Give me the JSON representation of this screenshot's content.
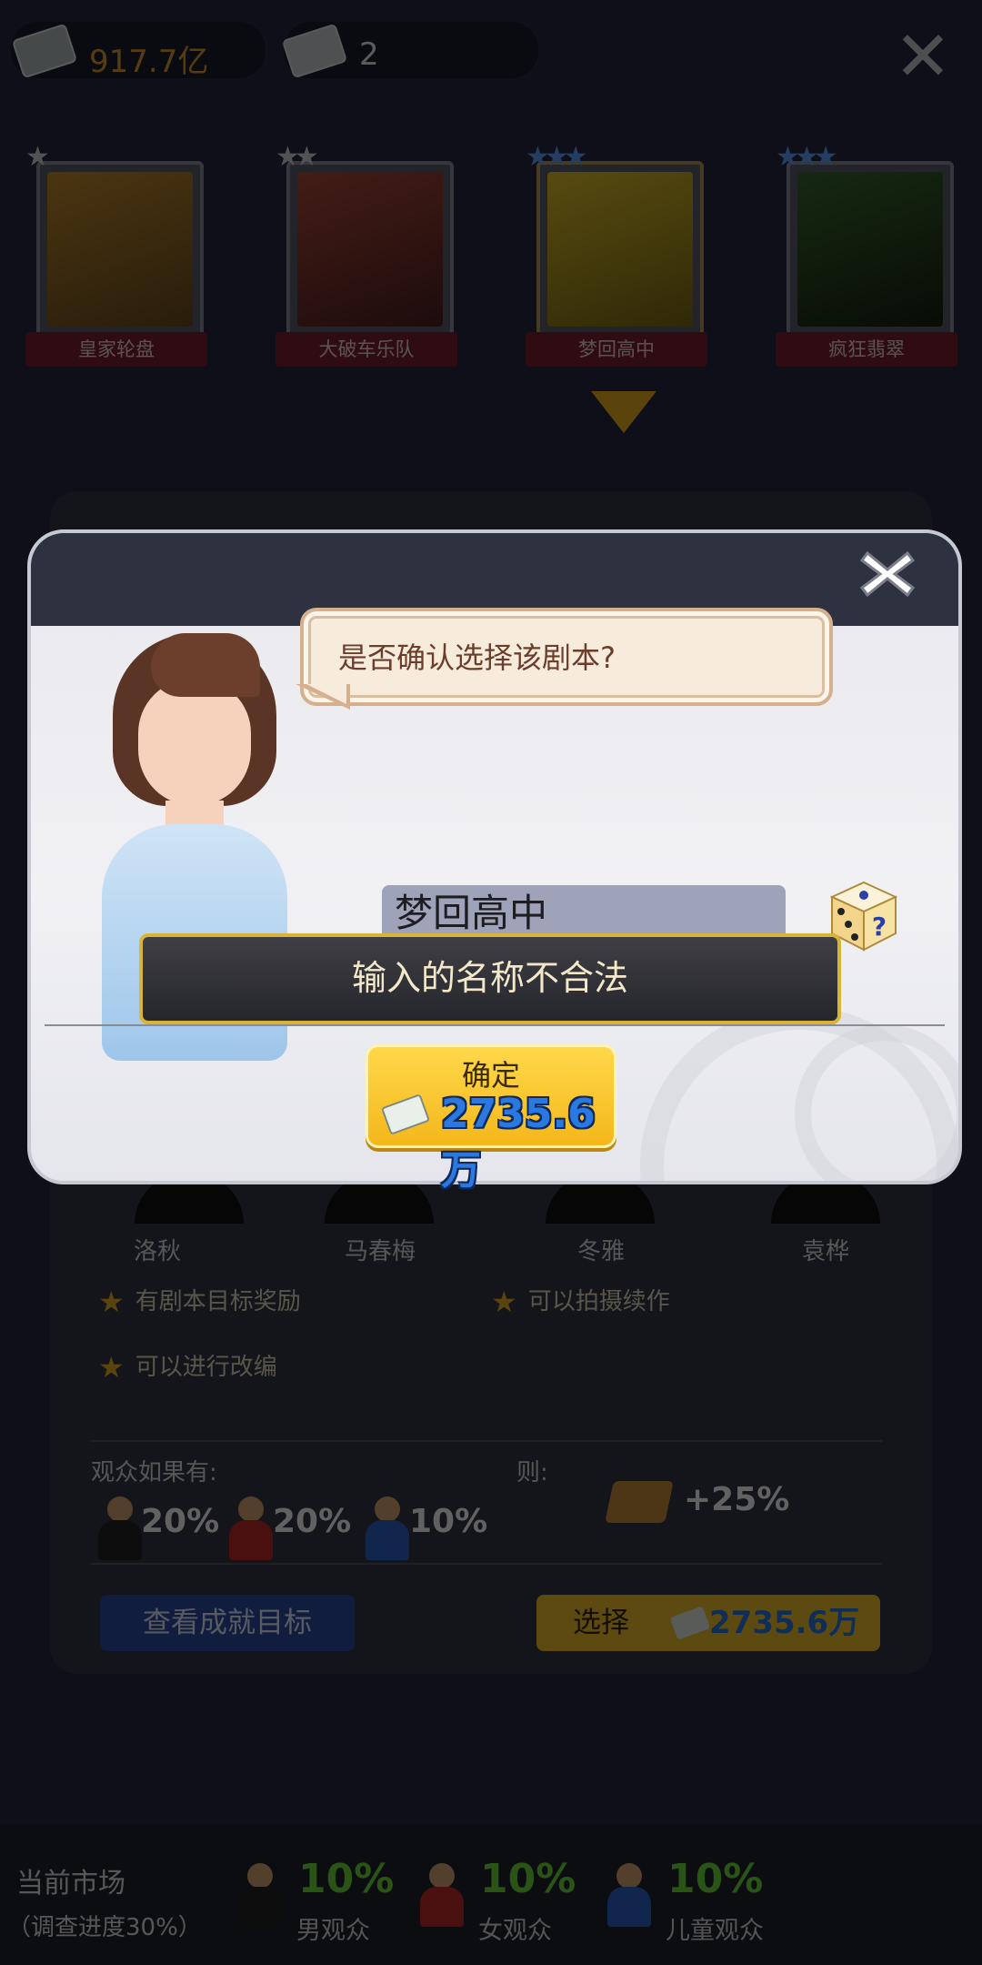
{
  "topbar": {
    "gold": "917.7亿",
    "tickets": "2"
  },
  "scripts": [
    {
      "title": "皇家轮盘",
      "stars": 1
    },
    {
      "title": "大破车乐队",
      "stars": 2
    },
    {
      "title": "梦回高中",
      "stars": 3
    },
    {
      "title": "疯狂翡翠",
      "stars": 3
    }
  ],
  "cast": [
    "洛秋",
    "马春梅",
    "冬雅",
    "袁桦"
  ],
  "features": {
    "reward": "有剧本目标奖励",
    "sequel": "可以拍摄续作",
    "adapt": "可以进行改编"
  },
  "audience_rule": {
    "if_label": "观众如果有:",
    "then_label": "则:",
    "male_pct": "20%",
    "female_pct": "20%",
    "child_pct": "10%",
    "bonus": "+25%"
  },
  "buttons": {
    "view_goals": "查看成就目标",
    "select": "选择",
    "select_price": "2735.6万"
  },
  "market": {
    "title": "当前市场",
    "progress": "（调查进度30%）",
    "male_pct": "10%",
    "male_label": "男观众",
    "female_pct": "10%",
    "female_label": "女观众",
    "child_pct": "10%",
    "child_label": "儿童观众"
  },
  "dialog": {
    "question": "是否确认选择该剧本?",
    "name_value": "梦回高中",
    "error_toast": "输入的名称不合法",
    "confirm_label": "确定",
    "confirm_price": "2735.6万"
  },
  "colors": {
    "accent_yellow": "#f4b71b",
    "price_blue": "#2b78e0",
    "market_green": "#6edc3a",
    "toast_border": "#d9b436"
  }
}
